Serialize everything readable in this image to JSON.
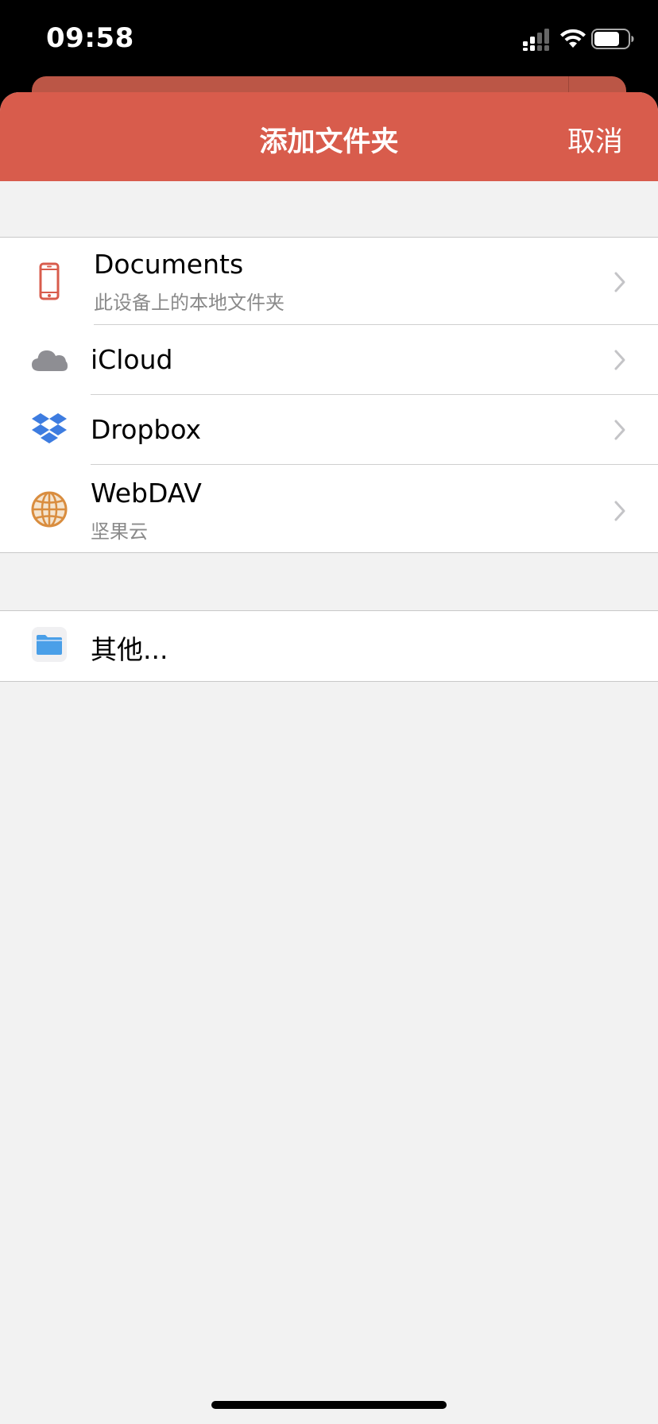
{
  "status_bar": {
    "time": "09:58",
    "icons": [
      "cellular-signal-icon",
      "wifi-icon",
      "battery-icon"
    ],
    "battery_level": 0.75
  },
  "sheet": {
    "title": "添加文件夹",
    "cancel_label": "取消",
    "accent_color": "#d85c4c"
  },
  "sources": [
    {
      "title": "Documents",
      "subtitle": "此设备上的本地文件夹",
      "icon": "phone-icon",
      "icon_color": "#d85c4c"
    },
    {
      "title": "iCloud",
      "icon": "cloud-icon",
      "icon_color": "#8e8e93"
    },
    {
      "title": "Dropbox",
      "icon": "dropbox-icon",
      "icon_color": "#3d7ce0"
    },
    {
      "title": "WebDAV",
      "subtitle": "坚果云",
      "icon": "globe-icon",
      "icon_color": "#d98d3f"
    }
  ],
  "other": {
    "title": "其他...",
    "icon": "folder-icon",
    "icon_color": "#4a9fe8"
  }
}
